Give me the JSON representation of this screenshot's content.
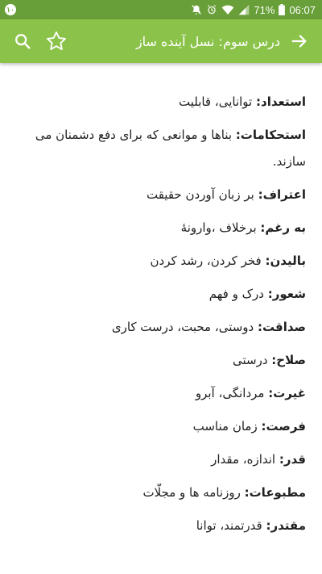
{
  "status_bar": {
    "notification_badge": "۱۰",
    "battery_percent": "71%",
    "time": "06:07",
    "colors": {
      "background": "#689f38"
    }
  },
  "app_bar": {
    "title": "درس سوم: نسل آینده ساز",
    "icons": {
      "back": "arrow-forward-icon",
      "favorite": "star-outline-icon",
      "search": "search-icon"
    },
    "colors": {
      "background": "#8bc34a",
      "foreground": "#ffffff"
    }
  },
  "vocabulary": [
    {
      "term": "استعداد:",
      "meaning": " توانایی، قابلیت"
    },
    {
      "term": "استحکامات:",
      "meaning": " بناها و موانعی که برای دفع دشمنان می سازند."
    },
    {
      "term": "اعتراف:",
      "meaning": " بر زبان آوردن حقیقت"
    },
    {
      "term": "به رغم:",
      "meaning": " برخلاف ،وارونهٔ"
    },
    {
      "term": "بالیدن:",
      "meaning": " فخر کردن، رشد کردن"
    },
    {
      "term": "شعور:",
      "meaning": " درک و فهم"
    },
    {
      "term": "صداقت:",
      "meaning": " دوستی، محبت، درست کاری"
    },
    {
      "term": "صلاح:",
      "meaning": " درستی"
    },
    {
      "term": "غیرت:",
      "meaning": " مردانگی، آبرو"
    },
    {
      "term": "فرصت:",
      "meaning": " زمان مناسب"
    },
    {
      "term": "قدر:",
      "meaning": " اندازه، مقدار"
    },
    {
      "term": "مطبوعات:",
      "meaning": "روزنامه ها و مجلّات"
    },
    {
      "term": "مقتدر:",
      "meaning": " قدرتمند، توانا"
    }
  ]
}
